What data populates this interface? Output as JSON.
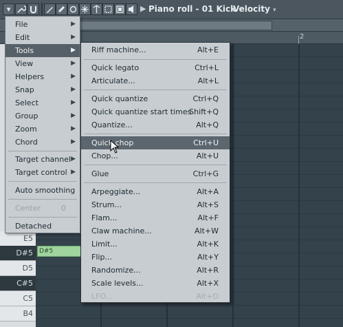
{
  "toolbar": {
    "icons": [
      "menu-dropdown-icon",
      "wrench-icon",
      "magnet-icon",
      "pencil-icon",
      "brush-icon",
      "delete-icon",
      "mute-icon",
      "slice-icon",
      "select-icon",
      "zoom-icon",
      "playback-icon"
    ],
    "title": "Piano roll - 01 Kick",
    "target": "Velocity"
  },
  "ruler": {
    "bar_number": "2"
  },
  "piano_keys": [
    {
      "label": "E5",
      "type": "white"
    },
    {
      "label": "D#5",
      "type": "black"
    },
    {
      "label": "D5",
      "type": "white"
    },
    {
      "label": "C#5",
      "type": "black"
    },
    {
      "label": "C5",
      "type": "white"
    },
    {
      "label": "B4",
      "type": "white"
    }
  ],
  "note": {
    "label": "D#5"
  },
  "main_menu": {
    "items": [
      {
        "label": "File",
        "submenu": true
      },
      {
        "label": "Edit",
        "submenu": true
      },
      {
        "label": "Tools",
        "submenu": true,
        "active": true
      },
      {
        "label": "View",
        "submenu": true
      },
      {
        "label": "Helpers",
        "submenu": true
      },
      {
        "label": "Snap",
        "submenu": true
      },
      {
        "label": "Select",
        "submenu": true
      },
      {
        "label": "Group",
        "submenu": true
      },
      {
        "label": "Zoom",
        "submenu": true
      },
      {
        "label": "Chord",
        "submenu": true
      },
      {
        "label": "Target channel",
        "submenu": true
      },
      {
        "label": "Target control",
        "submenu": true
      },
      {
        "label": "Auto smoothing",
        "submenu": false
      },
      {
        "label": "Center",
        "submenu": false,
        "disabled": true,
        "value": "0"
      },
      {
        "label": "Detached",
        "submenu": false
      }
    ]
  },
  "tools_menu": {
    "items": [
      {
        "label": "Riff machine...",
        "shortcut": "Alt+E"
      },
      {
        "label": "Quick legato",
        "shortcut": "Ctrl+L"
      },
      {
        "label": "Articulate...",
        "shortcut": "Alt+L"
      },
      {
        "label": "Quick quantize",
        "shortcut": "Ctrl+Q"
      },
      {
        "label": "Quick quantize start times",
        "shortcut": "Shift+Q"
      },
      {
        "label": "Quantize...",
        "shortcut": "Alt+Q"
      },
      {
        "label": "Quick chop",
        "shortcut": "Ctrl+U",
        "active": true
      },
      {
        "label": "Chop...",
        "shortcut": "Alt+U"
      },
      {
        "label": "Glue",
        "shortcut": "Ctrl+G"
      },
      {
        "label": "Arpeggiate...",
        "shortcut": "Alt+A"
      },
      {
        "label": "Strum...",
        "shortcut": "Alt+S"
      },
      {
        "label": "Flam...",
        "shortcut": "Alt+F"
      },
      {
        "label": "Claw machine...",
        "shortcut": "Alt+W"
      },
      {
        "label": "Limit...",
        "shortcut": "Alt+K"
      },
      {
        "label": "Flip...",
        "shortcut": "Alt+Y"
      },
      {
        "label": "Randomize...",
        "shortcut": "Alt+R"
      },
      {
        "label": "Scale levels...",
        "shortcut": "Alt+X"
      },
      {
        "label": "LFO...",
        "shortcut": "Alt+O",
        "disabled": true
      }
    ]
  },
  "colors": {
    "menu_bg": "#c7cdd1",
    "highlight": "#566068",
    "note": "#9fd49e"
  }
}
